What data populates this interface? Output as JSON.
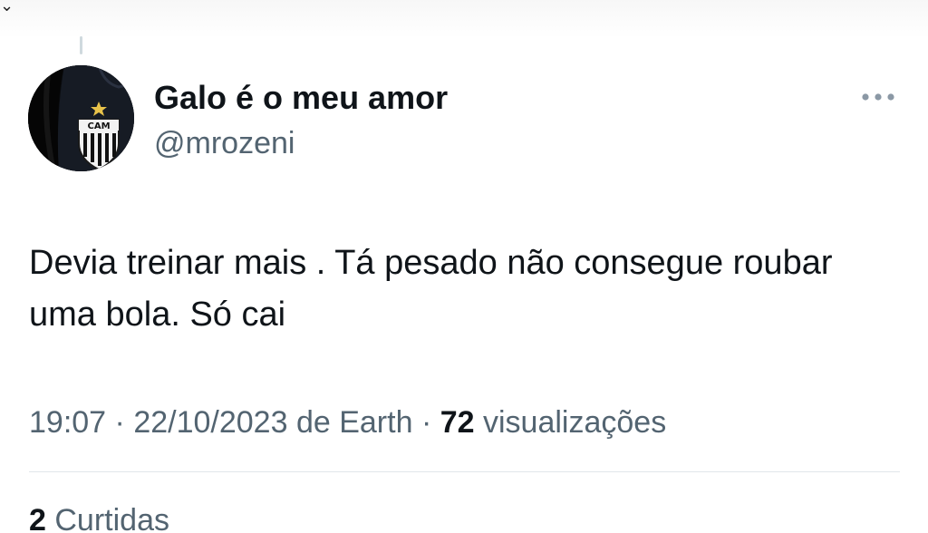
{
  "tweet": {
    "author": {
      "display_name": "Galo é o meu amor",
      "handle": "@mrozeni",
      "avatar_badge_text": "CAM"
    },
    "text": "Devia treinar mais . Tá pesado não consegue roubar uma bola. Só cai",
    "meta": {
      "time": "19:07",
      "separator": "·",
      "date": "22/10/2023",
      "source": "de Earth",
      "views_count": "72",
      "views_label": "visualizações"
    },
    "likes": {
      "count": "2",
      "label": "Curtidas"
    }
  },
  "icons": {
    "more": "more-horizontal-icon",
    "top": "chevron-icon"
  },
  "colors": {
    "text_primary": "#0f1419",
    "text_secondary": "#536471",
    "divider": "#e1e6ea",
    "thread_line": "#cfd9de"
  }
}
